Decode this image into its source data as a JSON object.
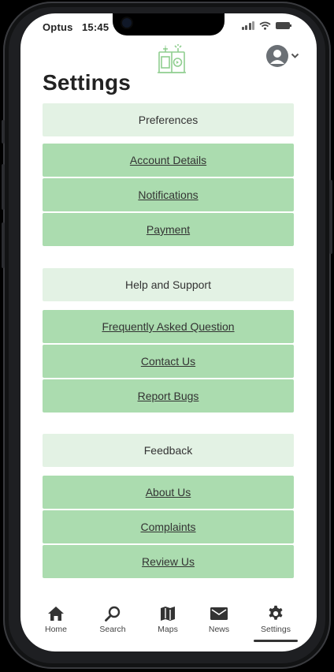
{
  "status_bar": {
    "carrier": "Optus",
    "time": "15:45"
  },
  "page": {
    "title": "Settings"
  },
  "sections": [
    {
      "header": "Preferences",
      "items": [
        "Account Details",
        "Notifications",
        "Payment"
      ]
    },
    {
      "header": "Help and Support",
      "items": [
        "Frequently Asked Question",
        "Contact Us",
        "Report Bugs"
      ]
    },
    {
      "header": "Feedback",
      "items": [
        "About Us",
        "Complaints",
        "Review Us"
      ]
    }
  ],
  "tabbar": {
    "tabs": [
      {
        "label": "Home",
        "icon": "home-icon"
      },
      {
        "label": "Search",
        "icon": "search-icon"
      },
      {
        "label": "Maps",
        "icon": "map-icon"
      },
      {
        "label": "News",
        "icon": "mail-icon"
      },
      {
        "label": "Settings",
        "icon": "gear-icon"
      }
    ],
    "active": "Settings"
  },
  "colors": {
    "section_header_bg": "#e3f2e4",
    "link_row_bg": "#abdcaf",
    "logo_green": "#8fce8f"
  }
}
